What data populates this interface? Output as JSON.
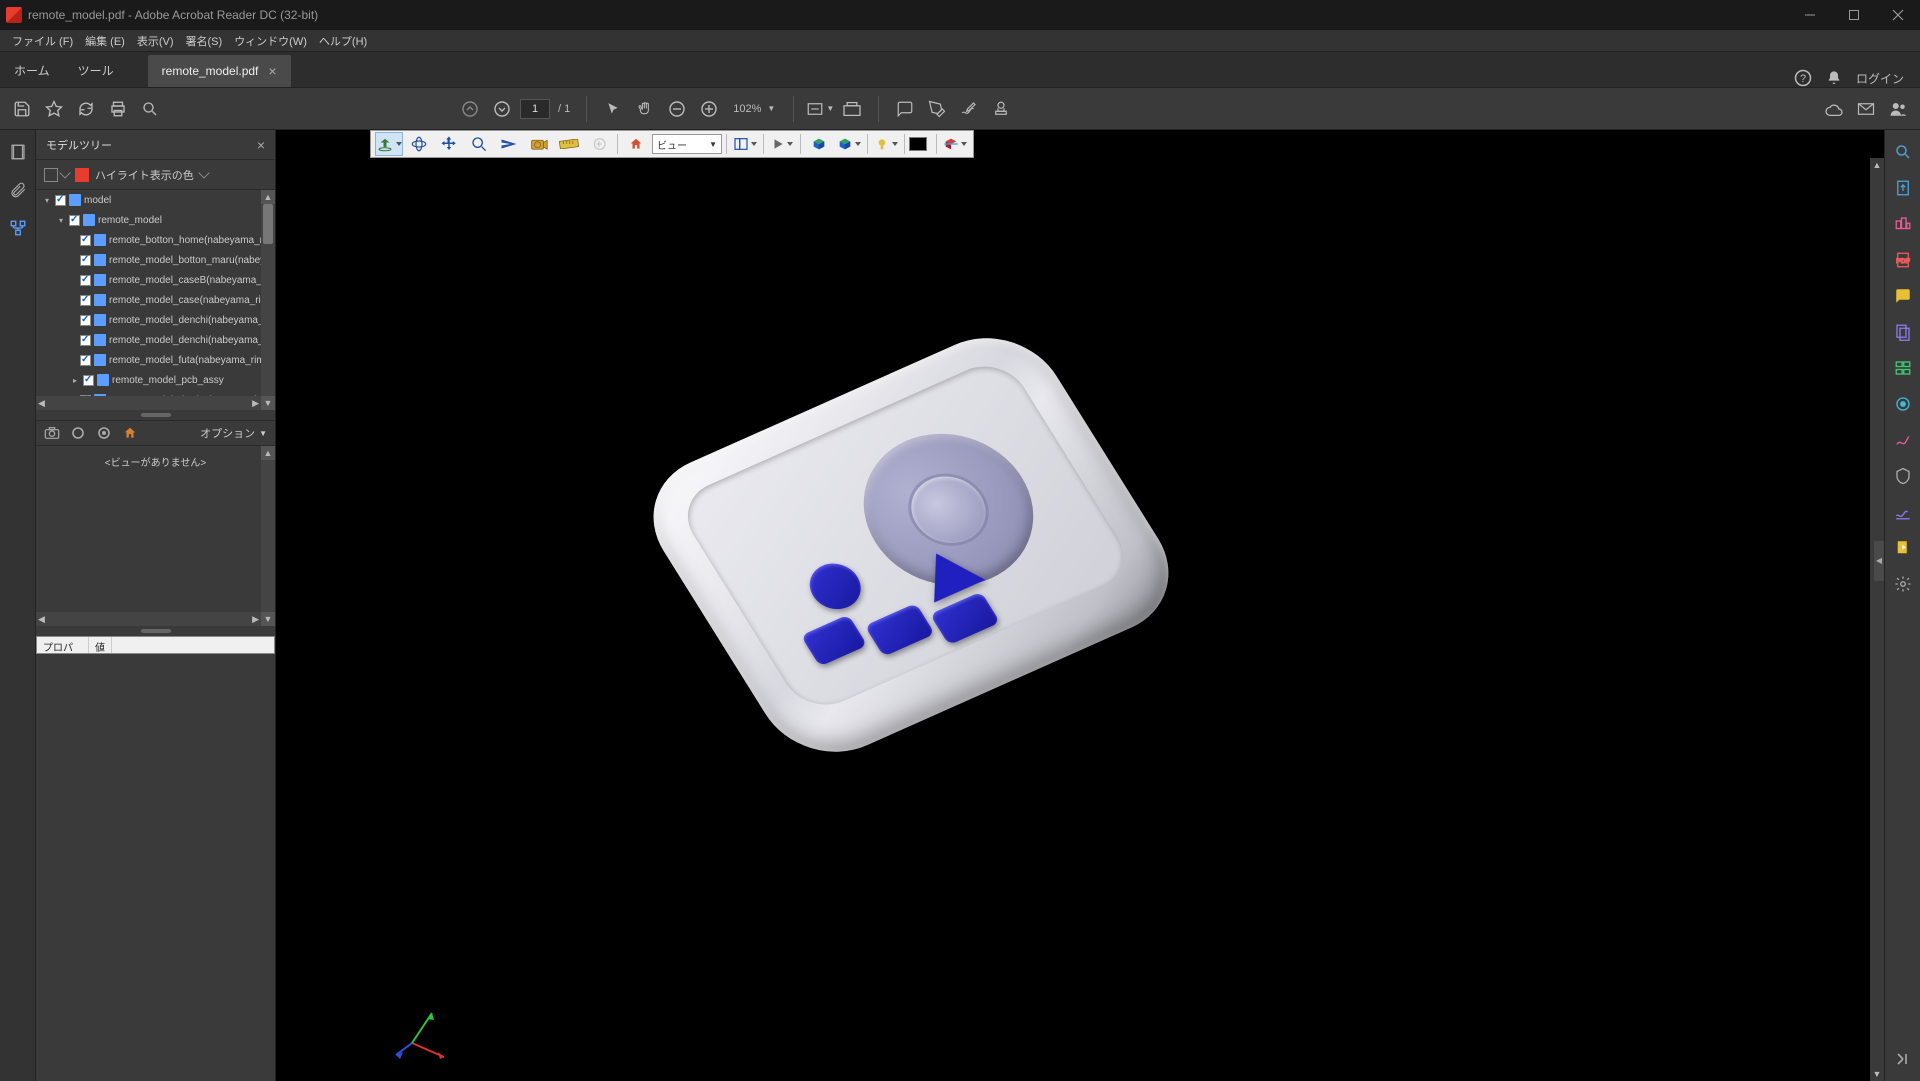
{
  "window": {
    "title": "remote_model.pdf - Adobe Acrobat Reader DC (32-bit)"
  },
  "menu": {
    "file": "ファイル (F)",
    "edit": "編集 (E)",
    "view": "表示(V)",
    "sign": "署名(S)",
    "window": "ウィンドウ(W)",
    "help": "ヘルプ(H)"
  },
  "tabs": {
    "home": "ホーム",
    "tools": "ツール",
    "doc": "remote_model.pdf",
    "login": "ログイン"
  },
  "toolbar": {
    "page_current": "1",
    "page_sep": "/ 1",
    "zoom": "102%"
  },
  "sidepanel": {
    "title": "モデルツリー",
    "highlight_label": "ハイライト表示の色",
    "tree": {
      "root": "model",
      "child": "remote_model",
      "items": [
        "remote_botton_home(nabeyama_rimoco",
        "remote_model_botton_maru(nabeyama_",
        "remote_model_caseB(nabeyama_rimoco",
        "remote_model_case(nabeyama_rimocon",
        "remote_model_denchi(nabeyama_rimoc",
        "remote_model_denchi(nabeyama_rimoc",
        "remote_model_futa(nabeyama_rimocon_",
        "remote_model_pcb_assy",
        "remote_model_ring(nabeyama_rimocon_"
      ]
    },
    "options": "オプション",
    "no_views": "<ビューがありません>",
    "prop_col1": "プロパティ",
    "prop_col2": "値"
  },
  "toolbar3d": {
    "view_label": "ビュー"
  }
}
